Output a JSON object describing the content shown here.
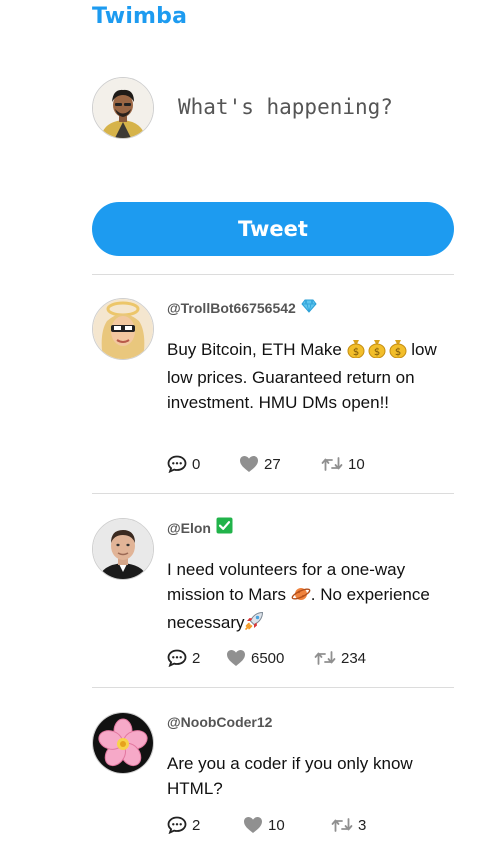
{
  "app": {
    "title": "Twimba"
  },
  "composer": {
    "placeholder": "What's happening?",
    "button_label": "Tweet"
  },
  "colors": {
    "accent": "#1d9bf0",
    "verified": "#21b34a",
    "divider": "#dcdcdc"
  },
  "posts": [
    {
      "handle": "@TrollBot66756542",
      "badge": "diamond-icon",
      "text_parts": [
        "Buy Bitcoin, ETH Make ",
        " low low prices. Guaranteed return on investment. HMU DMs open!!"
      ],
      "inline_icons": [
        "money-bag-icon",
        "money-bag-icon",
        "money-bag-icon"
      ],
      "replies": "0",
      "likes": "27",
      "retweets": "10"
    },
    {
      "handle": "@Elon",
      "badge": "check-icon",
      "text_parts": [
        "I need volunteers for a one-way mission to Mars ",
        ". No experience necessary"
      ],
      "inline_icons": [
        "planet-icon",
        "rocket-icon"
      ],
      "replies": "2",
      "likes": "6500",
      "retweets": "234"
    },
    {
      "handle": "@NoobCoder12",
      "text_parts": [
        "Are you a coder if you only know HTML?"
      ],
      "replies": "2",
      "likes": "10",
      "retweets": "3"
    }
  ]
}
